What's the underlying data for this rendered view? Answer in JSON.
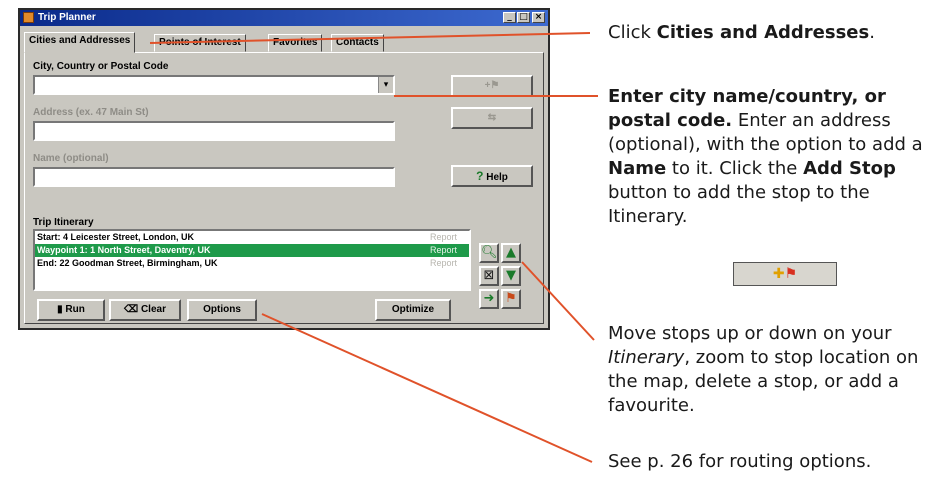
{
  "window": {
    "title": "Trip Planner",
    "controls": [
      "_",
      "□",
      "×"
    ],
    "tabs": [
      "Cities and Addresses",
      "Points of Interest",
      "Favorites",
      "Contacts"
    ],
    "active_tab": "Cities and Addresses"
  },
  "form": {
    "city_label": "City, Country or Postal Code",
    "city_value": "",
    "address_label": "Address (ex. 47 Main St)",
    "address_value": "",
    "name_label": "Name (optional)",
    "name_value": "",
    "help_label": "Help"
  },
  "itinerary": {
    "label": "Trip Itinerary",
    "rows": [
      {
        "text": "Start: 4 Leicester Street, London, UK",
        "action": "Report",
        "selected": false
      },
      {
        "text": "Waypoint 1: 1 North Street, Daventry, UK",
        "action": "Report",
        "selected": true
      },
      {
        "text": "End: 22 Goodman Street, Birmingham, UK",
        "action": "Report",
        "selected": false
      }
    ]
  },
  "bottom_buttons": {
    "run": "Run",
    "clear": "Clear",
    "options": "Options",
    "optimize": "Optimize"
  },
  "annotations": {
    "a1_pre": "Click ",
    "a1_bold": "Cities and Addresses",
    "a1_post": ".",
    "a2_bold": "Enter city name/country, or postal code.",
    "a2_rest": " Enter an address (optional), with the option to add a ",
    "a2_name": "Name",
    "a2_mid": " to it. Click the ",
    "a2_add": "Add Stop",
    "a2_end": " button to add the stop to the Itinerary.",
    "a3_pre": "Move stops up or down on your ",
    "a3_italic": "Itinerary",
    "a3_post": ", zoom to stop location on the map, delete a stop, or add a favourite.",
    "a4": "See p. 26 for routing options."
  },
  "colors": {
    "title_bar": "#0a2a8a",
    "selection": "#1e9a4a",
    "callout_line": "#e0522a",
    "window_face": "#c9c7c0"
  }
}
